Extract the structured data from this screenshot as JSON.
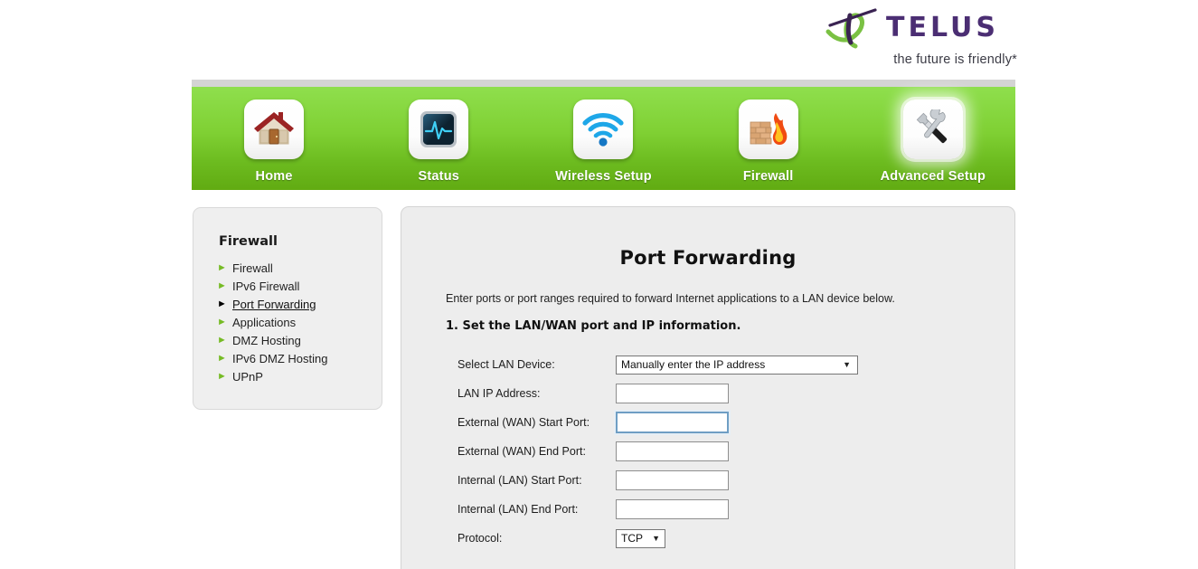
{
  "brand": {
    "name": "TELUS",
    "tagline": "the future is friendly*",
    "purple": "#4b2e73",
    "green": "#7ac143"
  },
  "nav": {
    "items": [
      {
        "label": "Home",
        "icon": "house-icon",
        "active": false
      },
      {
        "label": "Status",
        "icon": "heartbeat-monitor-icon",
        "active": false
      },
      {
        "label": "Wireless Setup",
        "icon": "wifi-icon",
        "active": false
      },
      {
        "label": "Firewall",
        "icon": "firewall-flame-icon",
        "active": false
      },
      {
        "label": "Advanced Setup",
        "icon": "tools-icon",
        "active": true
      }
    ]
  },
  "sidebar": {
    "title": "Firewall",
    "items": [
      {
        "label": "Firewall",
        "active": false
      },
      {
        "label": "IPv6 Firewall",
        "active": false
      },
      {
        "label": "Port Forwarding",
        "active": true
      },
      {
        "label": "Applications",
        "active": false
      },
      {
        "label": "DMZ Hosting",
        "active": false
      },
      {
        "label": "IPv6 DMZ Hosting",
        "active": false
      },
      {
        "label": "UPnP",
        "active": false
      }
    ]
  },
  "main": {
    "title": "Port Forwarding",
    "description": "Enter ports or port ranges required to forward Internet applications to a LAN device below.",
    "step1": "1. Set the LAN/WAN port and IP information.",
    "fields": {
      "select_lan_device": {
        "label": "Select LAN Device:",
        "value": "Manually enter the IP address"
      },
      "lan_ip_address": {
        "label": "LAN IP Address:",
        "value": "",
        "placeholder": ""
      },
      "external_wan_start_port": {
        "label": "External (WAN) Start Port:",
        "value": "",
        "placeholder": "",
        "focused": true
      },
      "external_wan_end_port": {
        "label": "External (WAN) End Port:",
        "value": "",
        "placeholder": ""
      },
      "internal_lan_start_port": {
        "label": "Internal (LAN) Start Port:",
        "value": "",
        "placeholder": ""
      },
      "internal_lan_end_port": {
        "label": "Internal (LAN) End Port:",
        "value": "",
        "placeholder": ""
      },
      "protocol": {
        "label": "Protocol:",
        "value": "TCP"
      }
    }
  },
  "icons": {
    "caret_down": "▼",
    "arrow_right": "►"
  }
}
